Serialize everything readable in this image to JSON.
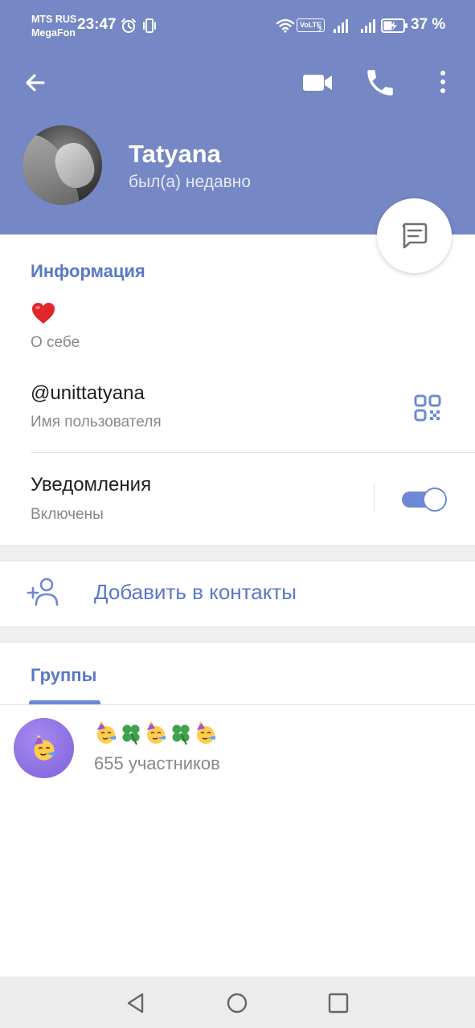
{
  "status_bar": {
    "carrier_line1": "MTS RUS",
    "carrier_line2": "MegaFon",
    "time": "23:47",
    "volte": "VoLTE",
    "volte_sub": "2",
    "battery": "37 %"
  },
  "header": {
    "name": "Tatyana",
    "status": "был(а) недавно",
    "color": "#7587c4"
  },
  "info": {
    "title": "Информация",
    "bio_emoji": "heart-emoji",
    "bio_caption": "О себе",
    "username": "@unittatyana",
    "username_caption": "Имя пользователя",
    "notifications_title": "Уведомления",
    "notifications_caption": "Включены",
    "notifications_enabled": true
  },
  "add_contact": {
    "label": "Добавить в контакты"
  },
  "groups": {
    "tab_label": "Группы",
    "items": [
      {
        "title_icons": [
          "partying-face-emoji",
          "clover-emoji",
          "partying-face-emoji",
          "clover-emoji",
          "partying-face-emoji"
        ],
        "members": "655 участников"
      }
    ]
  },
  "accent_color": "#5878c9"
}
